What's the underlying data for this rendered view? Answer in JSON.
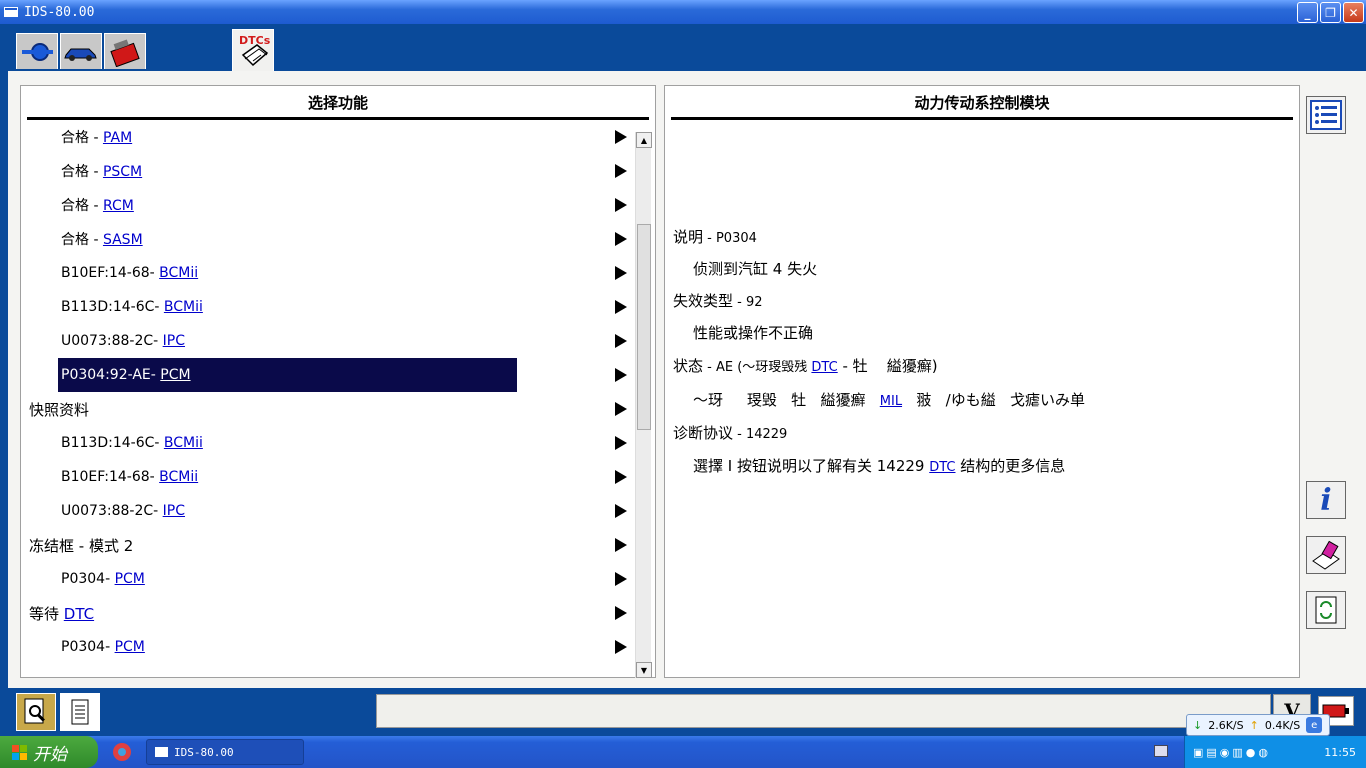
{
  "window": {
    "title": "IDS-80.00"
  },
  "toolbar": {
    "dtc_label": "DTCs"
  },
  "left_panel": {
    "header": "选择功能",
    "rows": [
      {
        "prefix": "合格 - ",
        "link": "PAM",
        "level": "child"
      },
      {
        "prefix": "合格 - ",
        "link": "PSCM",
        "level": "child"
      },
      {
        "prefix": "合格 - ",
        "link": "RCM",
        "level": "child"
      },
      {
        "prefix": "合格 - ",
        "link": "SASM",
        "level": "child"
      },
      {
        "prefix": "B10EF:14-68- ",
        "link": "BCMii",
        "level": "child"
      },
      {
        "prefix": "B113D:14-6C- ",
        "link": "BCMii",
        "level": "child"
      },
      {
        "prefix": "U0073:88-2C- ",
        "link": "IPC",
        "level": "child"
      },
      {
        "prefix": "P0304:92-AE- ",
        "link": "PCM",
        "level": "child",
        "selected": true
      },
      {
        "prefix": "快照资料",
        "link": "",
        "level": "parent"
      },
      {
        "prefix": "B113D:14-6C- ",
        "link": "BCMii",
        "level": "child"
      },
      {
        "prefix": "B10EF:14-68- ",
        "link": "BCMii",
        "level": "child"
      },
      {
        "prefix": "U0073:88-2C- ",
        "link": "IPC",
        "level": "child"
      },
      {
        "prefix": "冻结框 - 模式 2",
        "link": "",
        "level": "parent"
      },
      {
        "prefix": "P0304- ",
        "link": "PCM",
        "level": "child"
      },
      {
        "prefix": "等待 ",
        "link": "DTC",
        "level": "parent"
      },
      {
        "prefix": "P0304- ",
        "link": "PCM",
        "level": "child"
      }
    ]
  },
  "right_panel": {
    "header": "动力传动系控制模块",
    "desc_label": "说明",
    "desc_code": " - P0304",
    "desc_text": "侦测到汽缸 4 失火",
    "failure_label": "失效类型",
    "failure_code": " - 92",
    "failure_text": "性能或操作不正确",
    "status_label": "状态",
    "status_pre": " - AE (～玡琝毁残 ",
    "status_link": "DTC",
    "status_post": " - 牡     縊獶癬)",
    "status_line2_pre": "～玡     琝毁   牡   縊獶癬   ",
    "status_line2_link": "MIL",
    "status_line2_post": "   翄   /ゆも縊   戈瘧いみ单",
    "protocol_label": "诊断协议",
    "protocol_code": " - 14229",
    "protocol_pre": "選擇 I 按钮说明以了解有关 14229 ",
    "protocol_link": "DTC",
    "protocol_post": " 结构的更多信息"
  },
  "bottom": {
    "v_label": "V"
  },
  "netmeter": {
    "down": "2.6K/S",
    "up": "0.4K/S"
  },
  "taskbar": {
    "start_label": "开始",
    "task_title": "IDS-80.00",
    "clock": "11:55"
  }
}
